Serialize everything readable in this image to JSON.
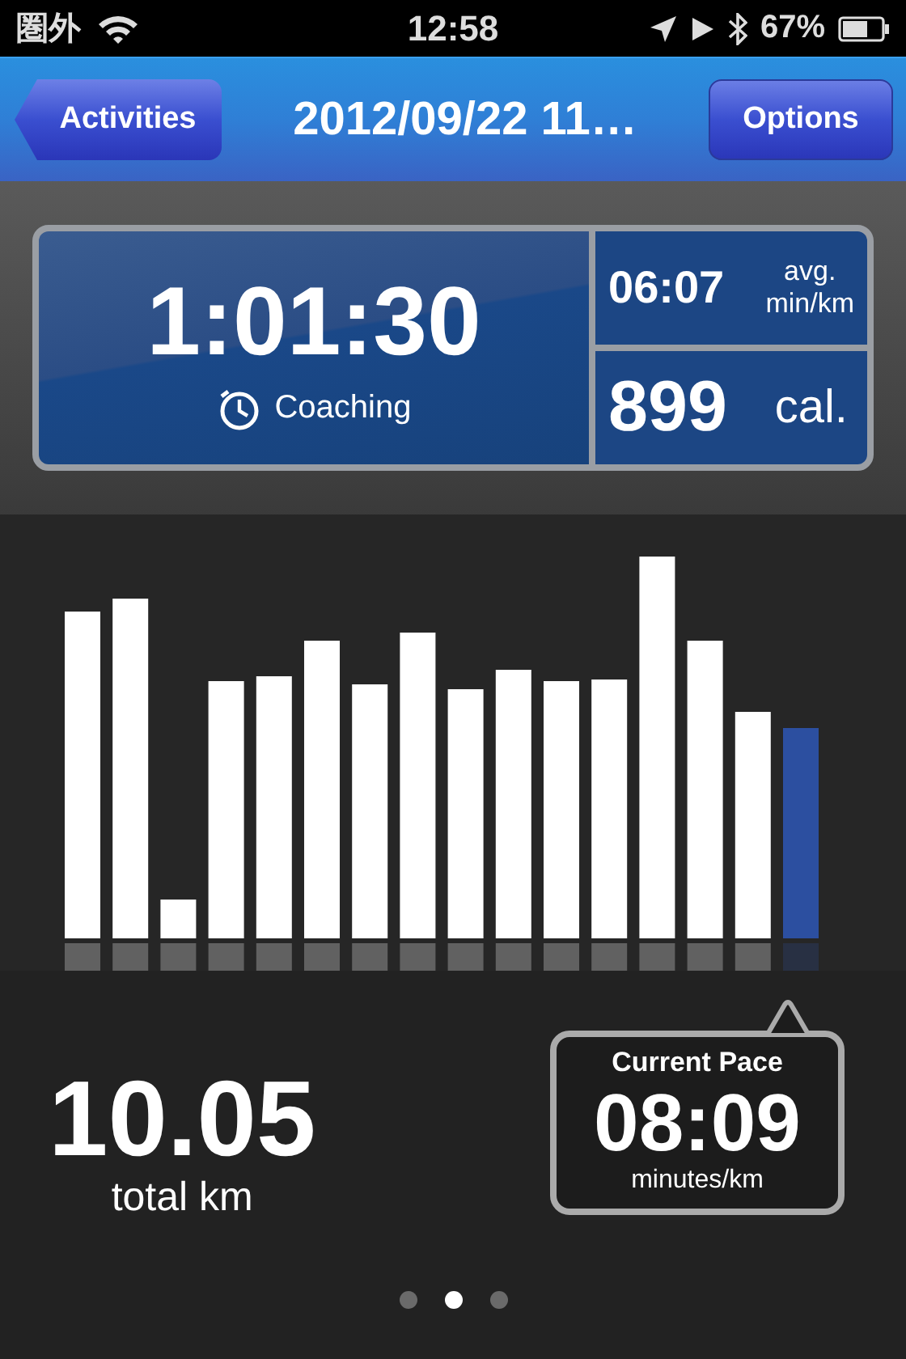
{
  "status_bar": {
    "carrier": "圏外",
    "time": "12:58",
    "battery": "67%"
  },
  "nav_bar": {
    "back_button": "Activities",
    "title": "2012/09/22 11…",
    "right_button": "Options"
  },
  "summary": {
    "duration": "1:01:30",
    "coaching": "Coaching",
    "avg_pace": "06:07",
    "avg_label": "avg.",
    "avg_unit": "min/km",
    "calories": "899",
    "calories_unit": "cal."
  },
  "distance": {
    "value": "10.05",
    "unit": "total km"
  },
  "current_pace": {
    "title": "Current Pace",
    "value": "08:09",
    "unit": "minutes/km"
  },
  "page_dots": [
    {
      "selected": false
    },
    {
      "selected": true
    },
    {
      "selected": false
    }
  ]
}
